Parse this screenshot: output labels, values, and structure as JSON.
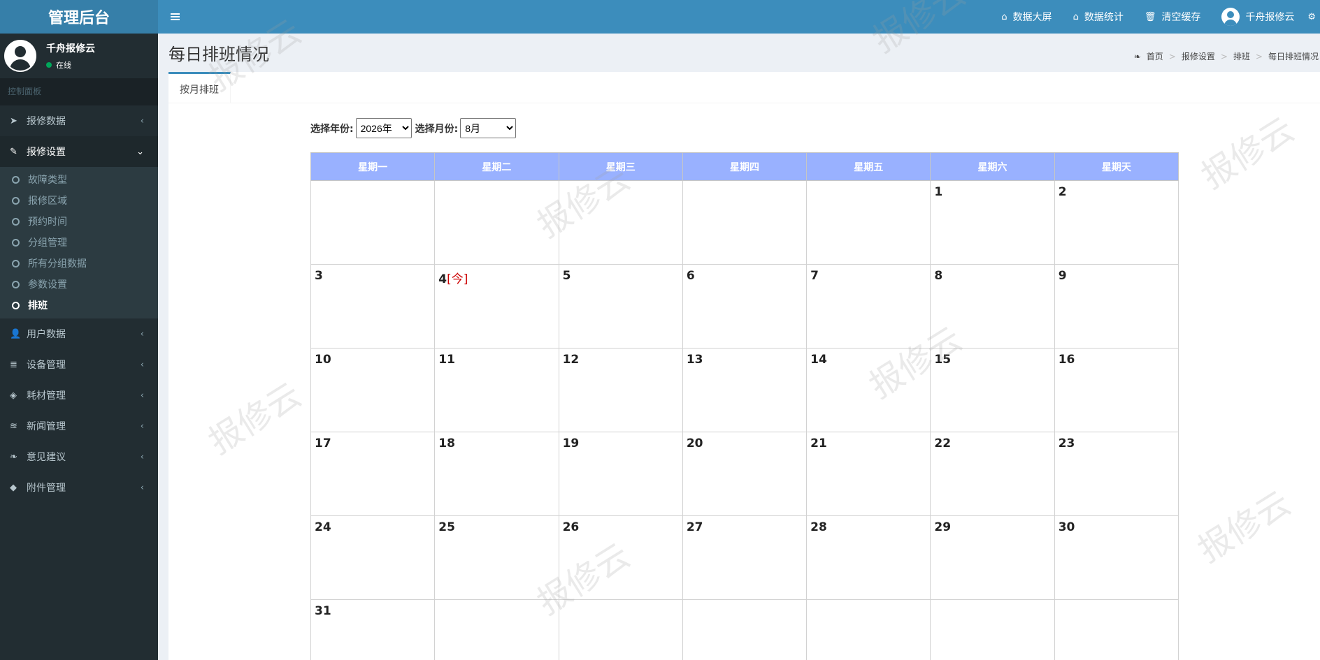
{
  "header": {
    "brand": "管理后台",
    "nav": [
      {
        "icon": "home-icon",
        "label": "数据大屏"
      },
      {
        "icon": "home-icon",
        "label": "数据统计"
      },
      {
        "icon": "trash-icon",
        "label": "清空缓存"
      }
    ],
    "user_name": "千舟报修云"
  },
  "sidebar": {
    "user": {
      "name": "千舟报修云",
      "status": "在线"
    },
    "section_title": "控制面板",
    "menu": [
      {
        "icon": "paper-plane-icon",
        "label": "报修数据"
      },
      {
        "icon": "wrench-icon",
        "label": "报修设置",
        "expanded": true,
        "children": [
          "故障类型",
          "报修区域",
          "预约时间",
          "分组管理",
          "所有分组数据",
          "参数设置",
          "排班"
        ],
        "current_child": "排班"
      },
      {
        "icon": "user-icon",
        "label": "用户数据"
      },
      {
        "icon": "database-icon",
        "label": "设备管理"
      },
      {
        "icon": "cube-icon",
        "label": "耗材管理"
      },
      {
        "icon": "rss-icon",
        "label": "新闻管理"
      },
      {
        "icon": "leaf-icon",
        "label": "意见建议"
      },
      {
        "icon": "tags-icon",
        "label": "附件管理"
      }
    ]
  },
  "page": {
    "title": "每日排班情况",
    "breadcrumb": [
      "首页",
      "报修设置",
      "排班",
      "每日排班情况"
    ],
    "tab": "按月排班",
    "filters": {
      "year_label": "选择年份:",
      "year_value": "2026年",
      "month_label": "选择月份:",
      "month_value": "8月"
    }
  },
  "calendar": {
    "weekdays": [
      "星期一",
      "星期二",
      "星期三",
      "星期四",
      "星期五",
      "星期六",
      "星期天"
    ],
    "weeks": [
      [
        "",
        "",
        "",
        "",
        "",
        "1",
        "2"
      ],
      [
        "3",
        "4",
        "5",
        "6",
        "7",
        "8",
        "9"
      ],
      [
        "10",
        "11",
        "12",
        "13",
        "14",
        "15",
        "16"
      ],
      [
        "17",
        "18",
        "19",
        "20",
        "21",
        "22",
        "23"
      ],
      [
        "24",
        "25",
        "26",
        "27",
        "28",
        "29",
        "30"
      ],
      [
        "31",
        "",
        "",
        "",
        "",
        "",
        ""
      ]
    ],
    "today": "4",
    "today_mark": "[今]"
  },
  "watermark": "报修云",
  "colors": {
    "header": "#3c8dbc",
    "brand_bg": "#367fa9",
    "sidebar": "#222d32",
    "weekday_header": "#99b1ff",
    "today": "#cc0000"
  }
}
